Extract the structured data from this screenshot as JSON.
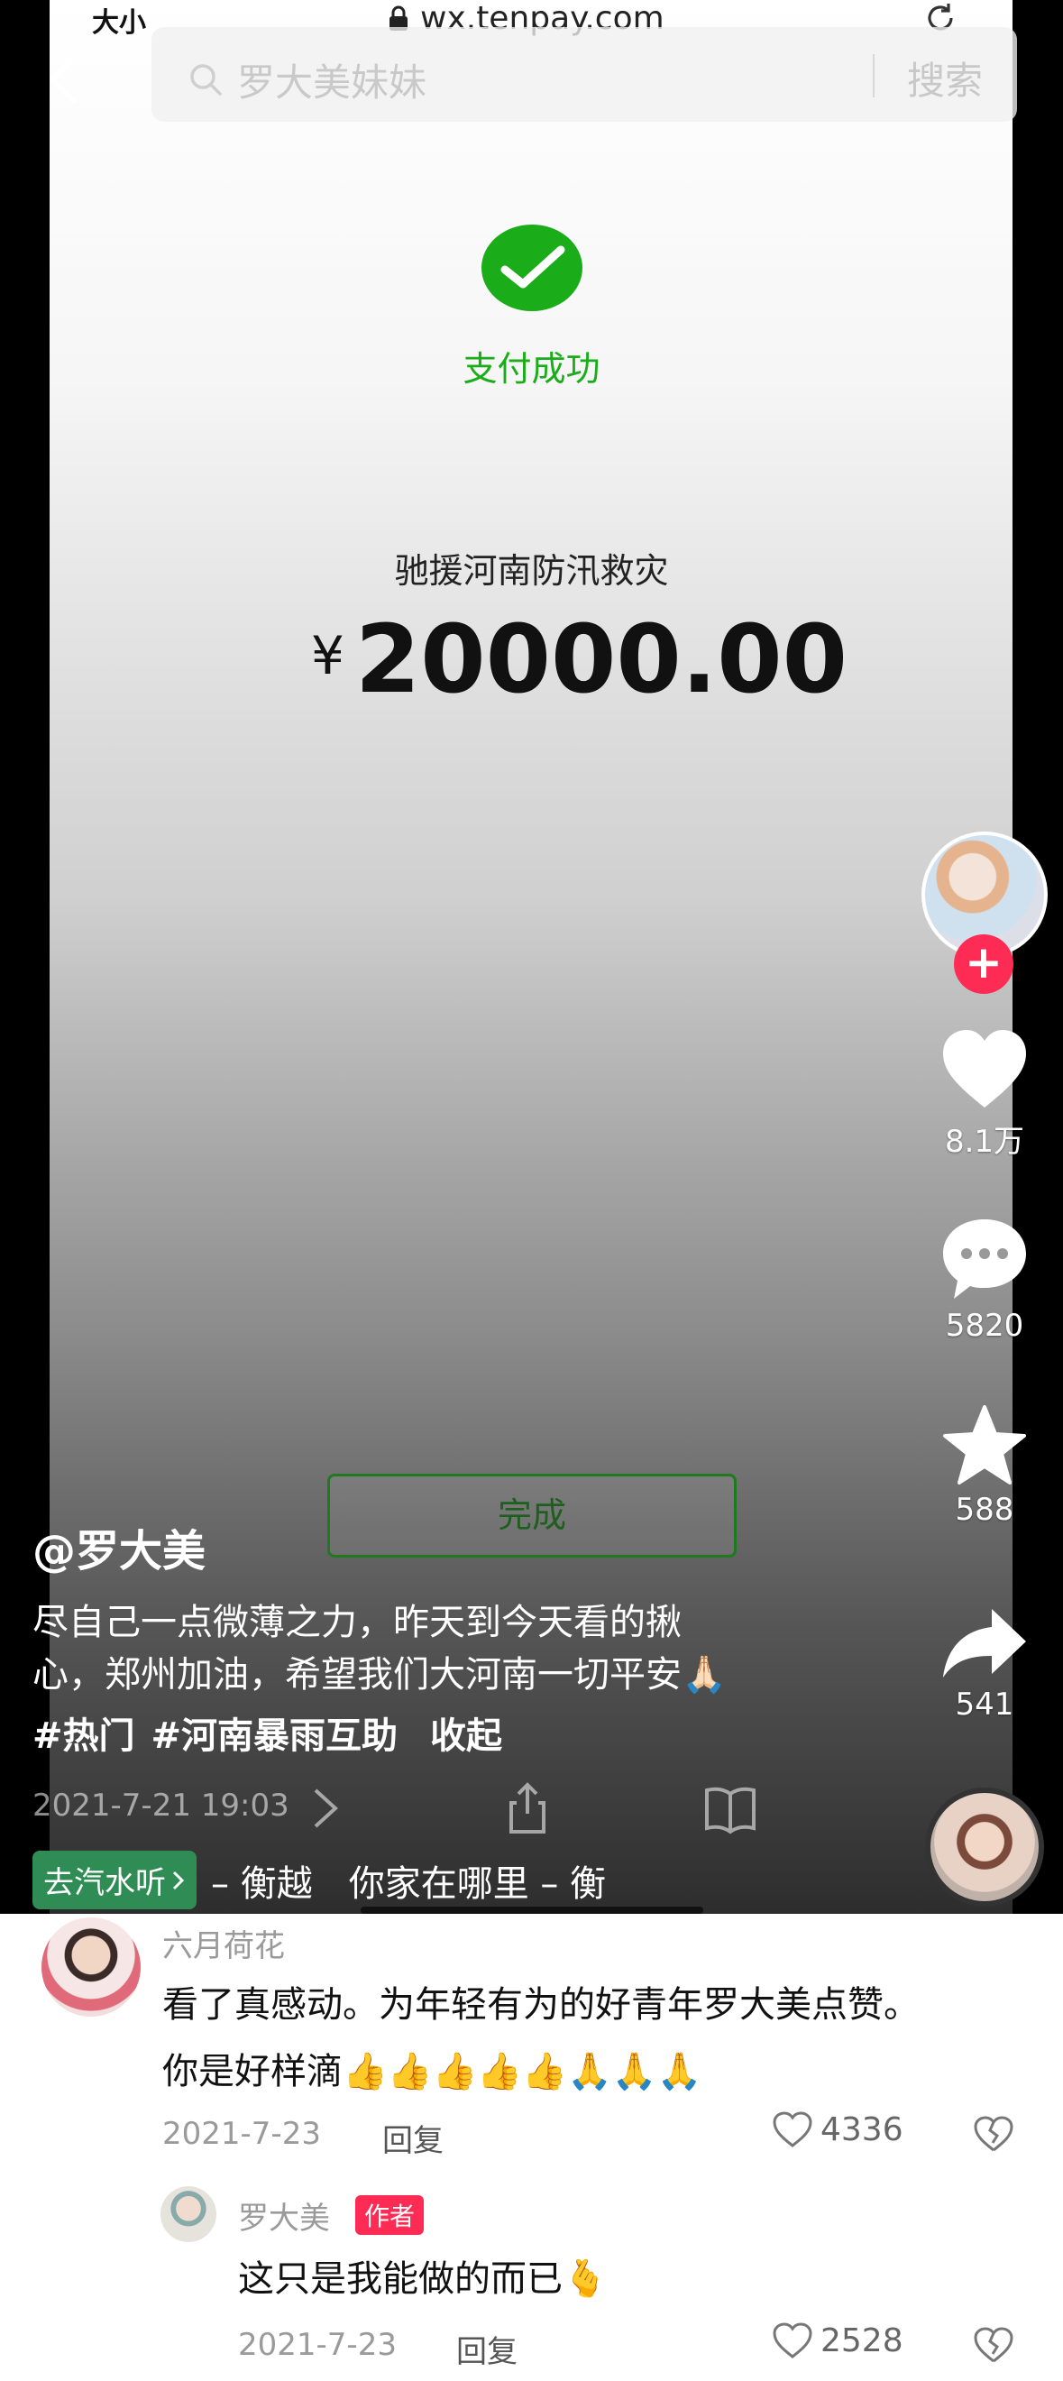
{
  "browser": {
    "font_size_label": "大小",
    "url": "wx.tenpay.com"
  },
  "search": {
    "placeholder_text": "罗大美妹妹",
    "button": "搜索"
  },
  "payment": {
    "status": "支付成功",
    "description": "驰援河南防汛救灾",
    "currency": "¥",
    "amount": "20000.00",
    "done_button": "完成"
  },
  "actions": {
    "likes": "8.1万",
    "comments": "5820",
    "favorites": "588",
    "shares": "541"
  },
  "post": {
    "author": "@罗大美",
    "caption_line1": "尽自己一点微薄之力，昨天到今天看的揪",
    "caption_line2": "心，郑州加油，希望我们大河南一切平安🙏🏻",
    "hashtags": [
      "#热门",
      "#河南暴雨互助",
      "收起"
    ],
    "timestamp": "2021-7-21 19:03",
    "music_tag": "去汽水听",
    "music_text": "– 衡越　你家在哪里 – 衡"
  },
  "comments": [
    {
      "user": "六月荷花",
      "line1": "看了真感动。为年轻有为的好青年罗大美点赞。",
      "line2": "你是好样滴👍👍👍👍👍🙏🙏🙏",
      "date": "2021-7-23",
      "reply_label": "回复",
      "likes": "4336"
    },
    {
      "user": "罗大美",
      "badge": "作者",
      "line1": "这只是我能做的而已🫰",
      "date": "2021-7-23",
      "reply_label": "回复",
      "likes": "2528"
    }
  ],
  "colors": {
    "wechat_green": "#1aad19",
    "douyin_red": "#fe2c55",
    "music_green": "#2f8c55"
  }
}
